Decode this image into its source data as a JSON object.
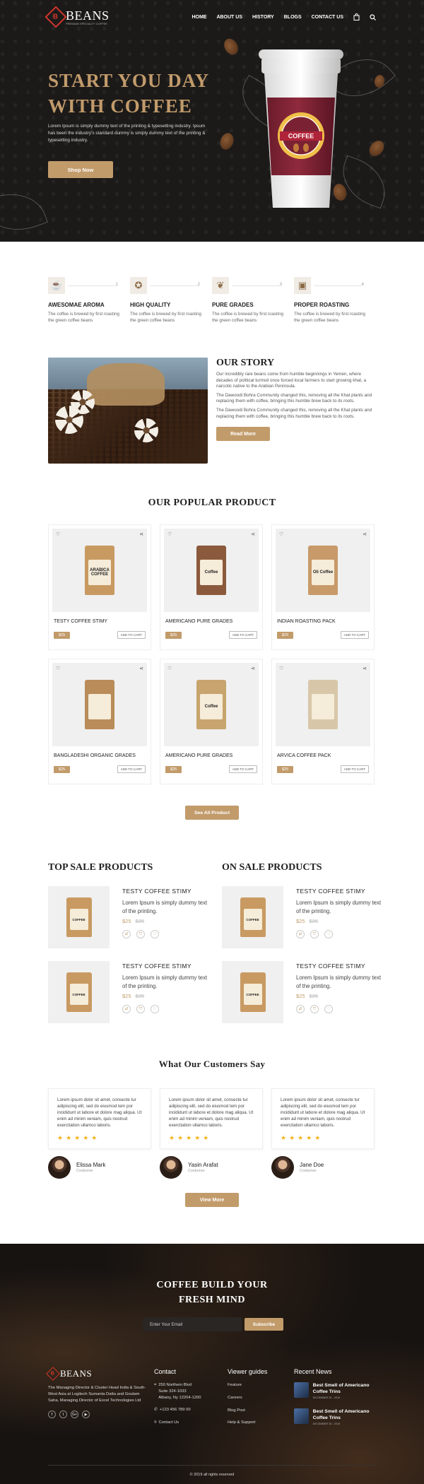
{
  "brand": {
    "name": "BEANS",
    "tagline": "PREMIUM SPECIALTY COFFEE"
  },
  "nav": {
    "items": [
      "HOME",
      "ABOUT US",
      "HISTORY",
      "BLOGS",
      "CONTACT US"
    ]
  },
  "hero": {
    "title_line1": "START YOU DAY",
    "title_line2": "WITH COFFEE",
    "text": "Lorem Ipsum is simply dummy text of the printing & typesetting industry. Ipsum has been the industry's standard dummy is simply dummy text of the printing & typesetting industry.",
    "button": "Shop Now",
    "cup_label": "COFFEE"
  },
  "features": [
    {
      "title": "AWESOMAE AROMA",
      "text": "The coffee is brewed by first roasting the green coffee beans",
      "num": "1",
      "icon": "coffee-cup-icon",
      "glyph": "☕"
    },
    {
      "title": "HIGH QUALITY",
      "text": "The coffee is brewed by first roasting the green coffee beans",
      "num": "2",
      "icon": "badge-icon",
      "glyph": "✪"
    },
    {
      "title": "PURE GRADES",
      "text": "The coffee is brewed by first roasting the green coffee beans",
      "num": "3",
      "icon": "leaf-icon",
      "glyph": "❦"
    },
    {
      "title": "PROPER ROASTING",
      "text": "The coffee is brewed by first roasting the green coffee beans",
      "num": "4",
      "icon": "roaster-icon",
      "glyph": "▣"
    }
  ],
  "story": {
    "title": "OUR STORY",
    "p1": "Our incredibly rare beans come from humble beginnings in Yemen, where decades of political turmoil once forced local farmers to start growing khat, a narcotic native to the Arabian Peninsula.",
    "p2": "The Dawoodi Bohra Community changed this, removing all the Khat plants and replacing them with coffee, bringing this humble brew back to its roots.",
    "p3": "The Dawoodi Bohra Community changed this, removing all the Khat plants and replacing them with coffee, bringing this humble brew back to its roots.",
    "button": "Read More"
  },
  "products": {
    "title": "OUR POPULAR PRODUCT",
    "cart_label": "ADD TO CART",
    "items": [
      {
        "name": "TESTY COFFEE STIMY",
        "price": "$25",
        "bag_color": "#c89a62",
        "label": "ARABICA COFFEE"
      },
      {
        "name": "AMERICANO PURE GRADES",
        "price": "$25",
        "bag_color": "#8b5a3c",
        "label": "Coffee"
      },
      {
        "name": "INDIAN ROASTING PACK",
        "price": "$25",
        "bag_color": "#c89a6a",
        "label": "Oli Coffee"
      },
      {
        "name": "BANGLADESHI ORGANIC GRADES",
        "price": "$25",
        "bag_color": "#b98c59",
        "label": ""
      },
      {
        "name": "AMERICANO PURE GRADES",
        "price": "$25",
        "bag_color": "#c8a46e",
        "label": "Coffee"
      },
      {
        "name": "ARVICA COFFEE PACK",
        "price": "$25",
        "bag_color": "#d7c7a8",
        "label": ""
      }
    ],
    "view_all": "See All Product"
  },
  "top_sale": {
    "title": "TOP SALE PRODUCTS",
    "items": [
      {
        "name": "TESTY COFFEE STIMY",
        "text": "Lorem Ipsum is simply dummy text of the printing.",
        "price": "$25",
        "old": "$35"
      },
      {
        "name": "TESTY COFFEE STIMY",
        "text": "Lorem Ipsum is simply dummy text of the printing.",
        "price": "$25",
        "old": "$35"
      }
    ]
  },
  "on_sale": {
    "title": "ON SALE PRODUCTS",
    "items": [
      {
        "name": "TESTY COFFEE STIMY",
        "text": "Lorem Ipsum is simply dummy text of the printing.",
        "price": "$25",
        "old": "$35"
      },
      {
        "name": "TESTY COFFEE STIMY",
        "text": "Lorem Ipsum is simply dummy text of the printing.",
        "price": "$25",
        "old": "$35"
      }
    ]
  },
  "testimonials": {
    "title": "What Our Customers Say",
    "items": [
      {
        "text": "Lorem ipsum dolor sit amet, consecte tur adipiscing elit, sed do eiusmod tem por incididunt ut labore et dolore mag aliqua. Ut enim ad minim veniam, quis nostrud exercitation ullamco laboris.",
        "name": "Elissa Mark",
        "role": "Costumer",
        "rating": "★★★★★"
      },
      {
        "text": "Lorem ipsum dolor sit amet, consecte tur adipiscing elit, sed do eiusmod tem por incididunt ut labore et dolore mag aliqua. Ut enim ad minim veniam, quis nostrud exercitation ullamco laboris.",
        "name": "Yasin Arafat",
        "role": "Costumer",
        "rating": "★★★★★"
      },
      {
        "text": "Lorem ipsum dolor sit amet, consecte tur adipiscing elit, sed do eiusmod tem por incididunt ut labore et dolore mag aliqua. Ut enim ad minim veniam, quis nostrud exercitation ullamco laboris.",
        "name": "Jane Doe",
        "role": "Costumer",
        "rating": "★★★★★"
      }
    ],
    "button": "View More"
  },
  "newsletter": {
    "title_line1": "COFFEE BUILD YOUR",
    "title_line2": "FRESH MIND",
    "placeholder": "Enter Your Email",
    "button": "Subscribe"
  },
  "footer": {
    "about": "The Managing Director & Cluster Head India & South- West Asia at Logitech Sumanta Datta and Goutam Saha, Managing Director of Excel Technologies Ltd",
    "contact_title": "Contact",
    "address1": "250 Northern Blvd",
    "address2": "Suite 324-1033",
    "address3": "Albany, Ny 12204-1200",
    "phone": "+123 456 789 00",
    "contact_link": "Contact Us",
    "guides_title": "Viewer guides",
    "guides": [
      "Feature",
      "Careers",
      "Blog Post",
      "Help & Support"
    ],
    "news_title": "Recent News",
    "news": [
      {
        "title": "Best Smell of Americano Coffee Trins",
        "date": "DECEMBER 30 - 2019"
      },
      {
        "title": "Best Smell of Americano Coffee Trins",
        "date": "DECEMBER 30 - 2019"
      }
    ],
    "social": [
      "f",
      "t",
      "G+",
      "▶"
    ],
    "copyright": "© 2019 all rights reserved"
  }
}
